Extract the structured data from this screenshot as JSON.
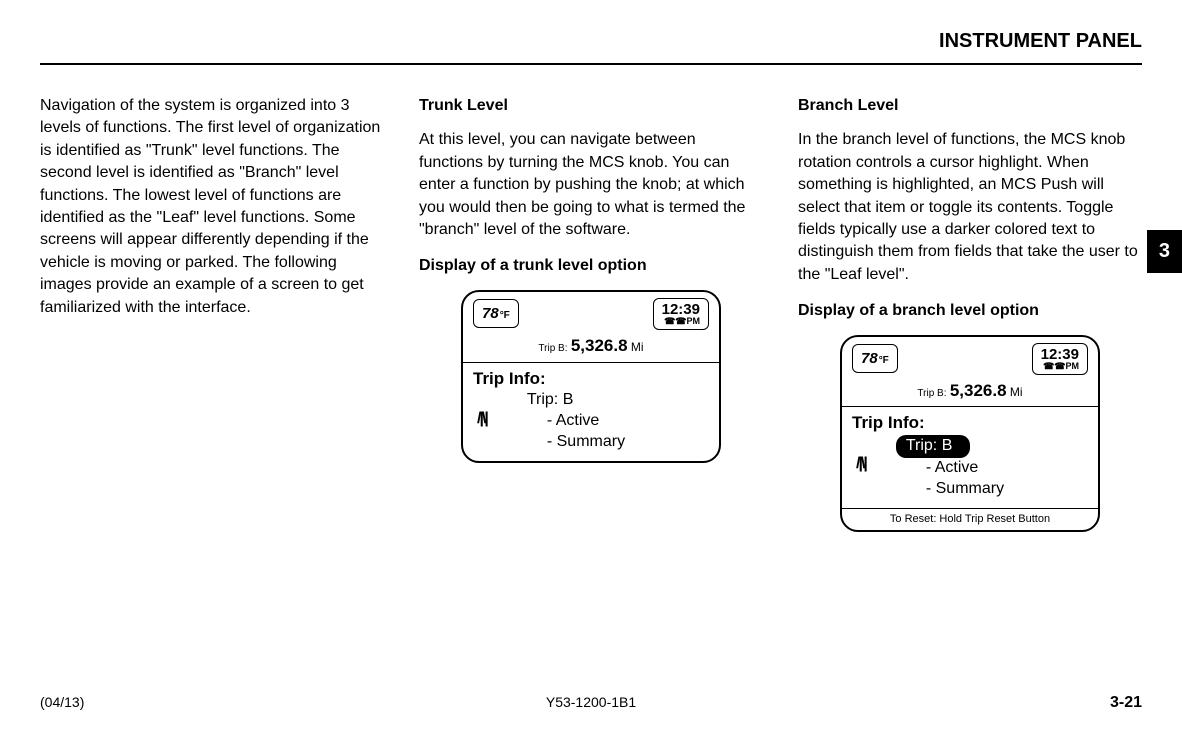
{
  "header": {
    "title": "INSTRUMENT PANEL"
  },
  "chapter_tab": "3",
  "column1": {
    "paragraph": "Navigation of the system is organized into 3 levels of functions. The first level of organization is identified as \"Trunk\" level functions. The second level is identified as \"Branch\" level functions. The lowest level of functions are identified as the \"Leaf\" level functions. Some screens will appear differently depending if the vehicle is moving or parked. The following images provide an example of a screen to get familiarized with the interface."
  },
  "column2": {
    "heading1": "Trunk Level",
    "paragraph1": "At this level, you can navigate between functions by turning the MCS knob. You can enter a function by pushing the knob; at which you would then be going to what is termed the \"branch\" level of the software.",
    "heading2": "Display of a trunk level option",
    "display": {
      "temp": "78",
      "temp_unit": "°F",
      "time": "12:39",
      "time_period": "☎☎PM",
      "trip_label": "Trip B:",
      "trip_sub": "Active",
      "trip_value": "5,326.8",
      "trip_unit": "Mi",
      "title": "Trip Info:",
      "trip_line": "Trip: B",
      "option1": "- Active",
      "option2": "- Summary",
      "compass_icon": "/|\\|"
    }
  },
  "column3": {
    "heading1": "Branch Level",
    "paragraph1": "In the branch level of functions, the MCS knob rotation controls a cursor highlight. When something is highlighted, an MCS Push will select that item or toggle its contents. Toggle fields typically use a darker colored text to distinguish them from fields that take the user to the \"Leaf level\".",
    "heading2": "Display of a branch level option",
    "display": {
      "temp": "78",
      "temp_unit": "°F",
      "time": "12:39",
      "time_period": "☎☎PM",
      "trip_label": "Trip B:",
      "trip_sub": "Active",
      "trip_value": "5,326.8",
      "trip_unit": "Mi",
      "title": "Trip Info:",
      "trip_line": "Trip: B",
      "option1": "- Active",
      "option2": "- Summary",
      "compass_icon": "/|\\|",
      "footer_note": "To Reset: Hold Trip Reset Button"
    }
  },
  "footer": {
    "left": "(04/13)",
    "center": "Y53-1200-1B1",
    "right": "3-21"
  }
}
